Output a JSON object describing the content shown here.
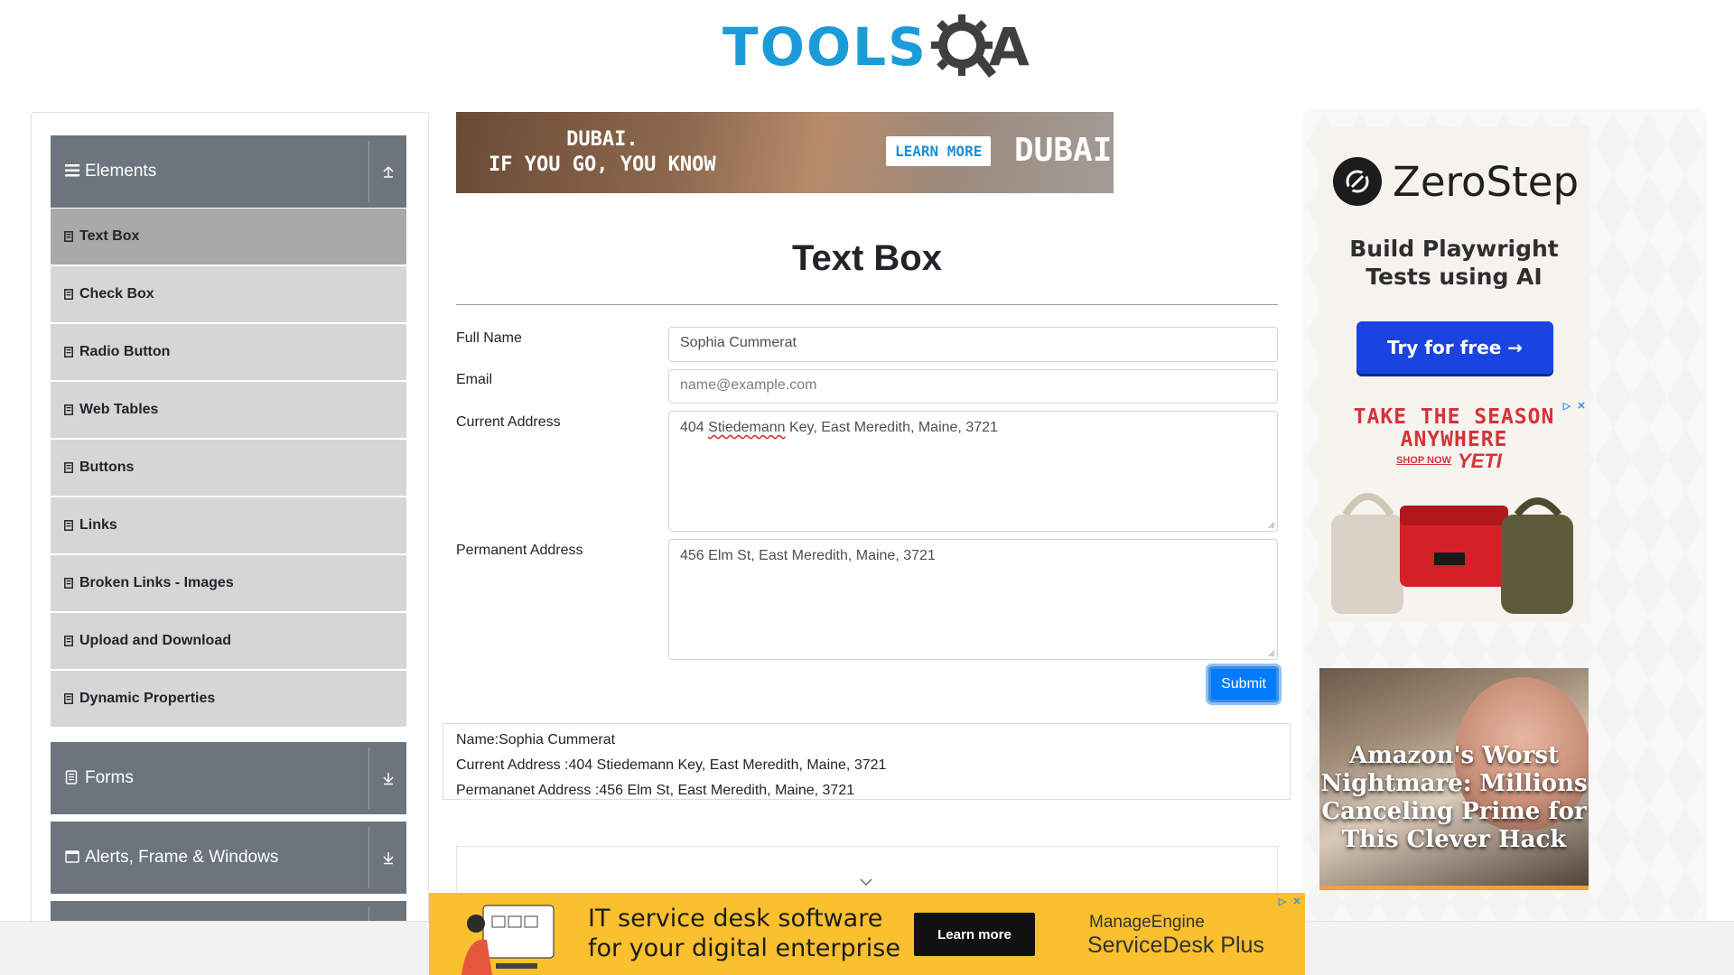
{
  "header": {
    "logo_tools": "TOOLS",
    "logo_a": "A"
  },
  "sidebar": {
    "groups": [
      {
        "label": "Elements",
        "icon": "hamburger-icon",
        "toggle_icon": "collapse-arrow-icon"
      },
      {
        "label": "Forms",
        "icon": "document-icon",
        "toggle_icon": "expand-arrow-icon"
      },
      {
        "label": "Alerts, Frame & Windows",
        "icon": "window-icon",
        "toggle_icon": "expand-arrow-icon"
      }
    ],
    "items": [
      {
        "label": "Text Box",
        "active": true
      },
      {
        "label": "Check Box"
      },
      {
        "label": "Radio Button"
      },
      {
        "label": "Web Tables"
      },
      {
        "label": "Buttons"
      },
      {
        "label": "Links"
      },
      {
        "label": "Broken Links - Images"
      },
      {
        "label": "Upload and Download"
      },
      {
        "label": "Dynamic Properties"
      }
    ]
  },
  "top_ad": {
    "line1": "DUBAI.",
    "line2": "IF YOU GO, YOU KNOW",
    "button": "LEARN MORE",
    "brand": "DUBAI"
  },
  "form": {
    "title": "Text Box",
    "full_name_label": "Full Name",
    "full_name_value": "Sophia Cummerat",
    "email_label": "Email",
    "email_placeholder": "name@example.com",
    "current_address_label": "Current Address",
    "current_address_value_pre": "404 ",
    "current_address_value_spell": "Stiedemann",
    "current_address_value_post": " Key, East Meredith, Maine, 3721",
    "permanent_address_label": "Permanent Address",
    "permanent_address_value": "456 Elm St, East Meredith, Maine, 3721",
    "submit_label": "Submit"
  },
  "output": {
    "name": "Name:Sophia Cummerat",
    "current_address": "Current Address :404 Stiedemann Key, East Meredith, Maine, 3721",
    "permanent_address": "Permananet Address :456 Elm St, East Meredith, Maine, 3721"
  },
  "right_ads": {
    "zerostep": {
      "name": "ZeroStep",
      "tagline_line1": "Build Playwright",
      "tagline_line2": "Tests using AI",
      "button": "Try for free →"
    },
    "yeti": {
      "title_line1": "TAKE THE SEASON",
      "title_line2": "ANYWHERE",
      "shop": "SHOP NOW",
      "brand": "YETI"
    },
    "amazon": {
      "headline": "Amazon's Worst Nightmare: Millions Canceling Prime for This Clever Hack"
    }
  },
  "bottom_ad": {
    "line1": "IT service desk software",
    "line2": "for your digital enterprise",
    "button": "Learn more",
    "brand_line1": "ManageEngine",
    "brand_line2": "ServiceDesk Plus"
  },
  "colors": {
    "sidebar_header": "#6c757d",
    "menu_item": "#d6d6d6",
    "menu_item_active": "#a9a9a9",
    "primary": "#007bff",
    "logo_blue": "#1b9bd8"
  }
}
